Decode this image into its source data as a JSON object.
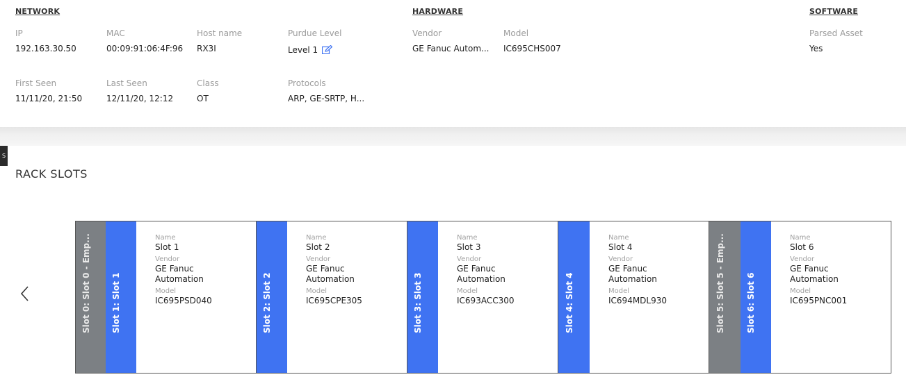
{
  "network": {
    "heading": "NETWORK",
    "ip": {
      "label": "IP",
      "value": "192.163.30.50"
    },
    "mac": {
      "label": "MAC",
      "value": "00:09:91:06:4F:96"
    },
    "host": {
      "label": "Host name",
      "value": "RX3I"
    },
    "purdue": {
      "label": "Purdue Level",
      "value": "Level 1"
    },
    "first_seen": {
      "label": "First Seen",
      "value": "11/11/20, 21:50"
    },
    "last_seen": {
      "label": "Last Seen",
      "value": "12/11/20, 12:12"
    },
    "class": {
      "label": "Class",
      "value": "OT"
    },
    "protocols": {
      "label": "Protocols",
      "value": "ARP, GE-SRTP, H..."
    }
  },
  "hardware": {
    "heading": "HARDWARE",
    "vendor": {
      "label": "Vendor",
      "value": "GE Fanuc Autom..."
    },
    "model": {
      "label": "Model",
      "value": "IC695CHS007"
    }
  },
  "software": {
    "heading": "SOFTWARE",
    "parsed": {
      "label": "Parsed Asset",
      "value": "Yes"
    }
  },
  "side_tab": "S",
  "rack": {
    "title": "RACK SLOTS",
    "field_labels": {
      "name": "Name",
      "vendor": "Vendor",
      "model": "Model"
    },
    "empty_strips": [
      {
        "label": "Slot 0: Slot 0 - Emp..."
      },
      {
        "label": "Slot 5: Slot 5 - Emp..."
      }
    ],
    "slots": [
      {
        "strip": "Slot 1: Slot 1",
        "name": "Slot 1",
        "vendor_l1": "GE Fanuc",
        "vendor_l2": "Automation",
        "model": "IC695PSD040"
      },
      {
        "strip": "Slot 2: Slot 2",
        "name": "Slot 2",
        "vendor_l1": "GE Fanuc",
        "vendor_l2": "Automation",
        "model": "IC695CPE305"
      },
      {
        "strip": "Slot 3: Slot 3",
        "name": "Slot 3",
        "vendor_l1": "GE Fanuc",
        "vendor_l2": "Automation",
        "model": "IC693ACC300"
      },
      {
        "strip": "Slot 4: Slot 4",
        "name": "Slot 4",
        "vendor_l1": "GE Fanuc",
        "vendor_l2": "Automation",
        "model": "IC694MDL930"
      },
      {
        "strip": "Slot 6: Slot 6",
        "name": "Slot 6",
        "vendor_l1": "GE Fanuc",
        "vendor_l2": "Automation",
        "model": "IC695PNC001"
      }
    ]
  },
  "colors": {
    "slot_blue": "#3f73f2",
    "slot_empty": "#7c8084",
    "edit_icon": "#3f73f2"
  }
}
